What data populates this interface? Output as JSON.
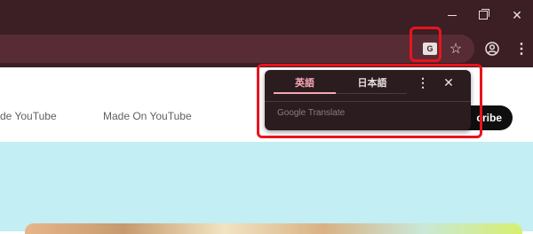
{
  "nav": {
    "item1": "de YouTube",
    "item2": "Made On YouTube"
  },
  "subscribe_label": "cribe",
  "translate": {
    "tab_en": "英語",
    "tab_ja": "日本語",
    "brand_google": "Google",
    "brand_translate": "Translate",
    "menu_icon": "⋮",
    "close_icon": "✕"
  },
  "toolbar": {
    "star_icon": "☆",
    "menu_icon": "⋮"
  },
  "window": {
    "min": "",
    "max": "",
    "close": "✕"
  },
  "colors": {
    "highlight": "#e8141e",
    "accent": "#f7a7b4",
    "frame": "#3b1f24"
  }
}
